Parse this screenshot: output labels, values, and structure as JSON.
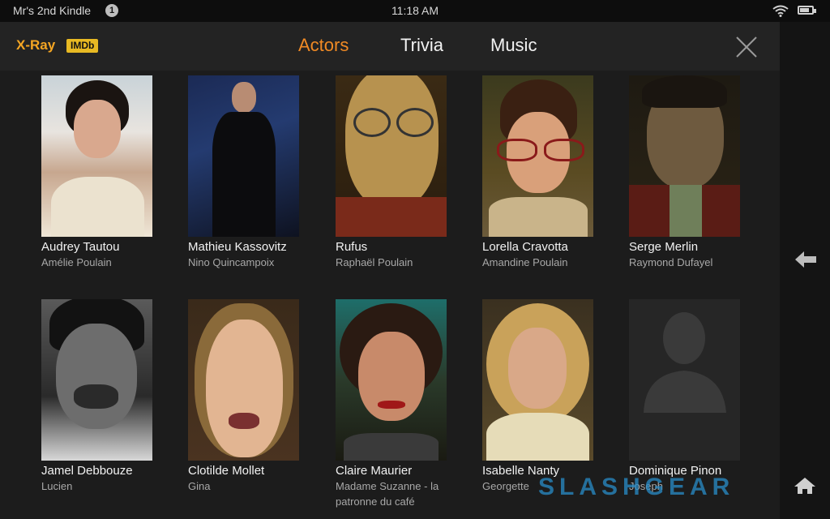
{
  "status_bar": {
    "device_name": "Mr's 2nd Kindle",
    "notification_count": "1",
    "time": "11:18 AM",
    "battery_level": 0.8
  },
  "header": {
    "xray_label": "X-Ray",
    "imdb_label": "IMDb",
    "tabs": [
      {
        "label": "Actors",
        "active": true
      },
      {
        "label": "Trivia",
        "active": false
      },
      {
        "label": "Music",
        "active": false
      }
    ]
  },
  "actors": [
    {
      "name": "Audrey Tautou",
      "role": "Amélie Poulain"
    },
    {
      "name": "Mathieu Kassovitz",
      "role": "Nino Quincampoix"
    },
    {
      "name": "Rufus",
      "role": "Raphaël Poulain"
    },
    {
      "name": "Lorella Cravotta",
      "role": "Amandine Poulain"
    },
    {
      "name": "Serge Merlin",
      "role": "Raymond Dufayel"
    },
    {
      "name": "Jamel Debbouze",
      "role": "Lucien"
    },
    {
      "name": "Clotilde Mollet",
      "role": "Gina"
    },
    {
      "name": "Claire Maurier",
      "role": "Madame Suzanne - la patronne du café"
    },
    {
      "name": "Isabelle Nanty",
      "role": "Georgette"
    },
    {
      "name": "Dominique Pinon",
      "role": "Joseph"
    }
  ],
  "watermark": "SLASHGEAR",
  "colors": {
    "accent": "#f08a24",
    "background": "#1c1c1c",
    "header": "#232323"
  }
}
